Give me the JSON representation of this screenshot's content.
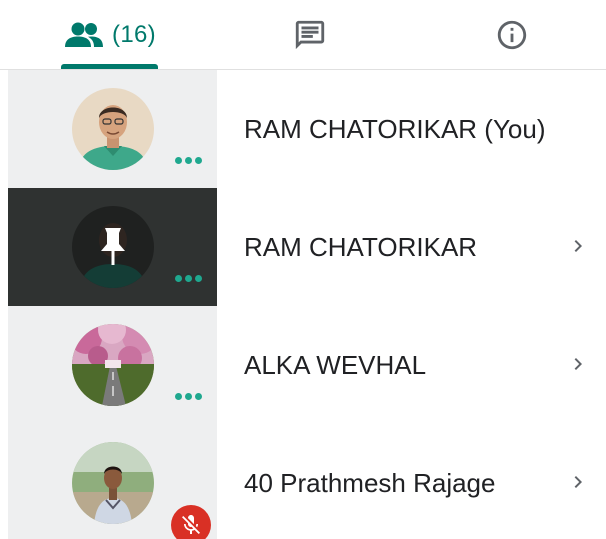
{
  "tabs": {
    "people": {
      "icon": "people-icon",
      "count": "(16)",
      "active": true
    },
    "chat": {
      "icon": "chat-icon"
    },
    "info": {
      "icon": "info-icon"
    }
  },
  "participants": [
    {
      "name": "RAM CHATORIKAR (You)",
      "avatar": "photo-man-green-shirt",
      "indicator": "more-dots",
      "chevron": false
    },
    {
      "name": "RAM CHATORIKAR",
      "avatar": "photo-dark-pinned",
      "indicator": "more-dots",
      "chevron": true,
      "pinned": true
    },
    {
      "name": "ALKA WEVHAL",
      "avatar": "photo-pink-tree-road",
      "indicator": "more-dots",
      "chevron": true
    },
    {
      "name": "40 Prathmesh Rajage",
      "avatar": "photo-boy-outdoor",
      "indicator": "muted-mic",
      "chevron": true
    }
  ],
  "colors": {
    "accent": "#00796b",
    "dots": "#1fa88f",
    "muted_badge": "#d93025",
    "tile_bg": "#eeeff0",
    "tile_bg_pinned": "#2f3231"
  }
}
